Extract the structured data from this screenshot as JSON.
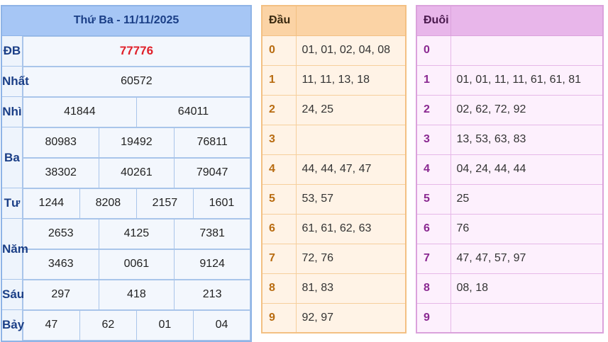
{
  "results": {
    "title": "Thứ Ba - 11/11/2025",
    "prizes": [
      {
        "name": "ĐB",
        "rows": [
          [
            "77776"
          ]
        ]
      },
      {
        "name": "Nhất",
        "rows": [
          [
            "60572"
          ]
        ]
      },
      {
        "name": "Nhì",
        "rows": [
          [
            "41844",
            "64011"
          ]
        ]
      },
      {
        "name": "Ba",
        "rows": [
          [
            "80983",
            "19492",
            "76811"
          ],
          [
            "38302",
            "40261",
            "79047"
          ]
        ]
      },
      {
        "name": "Tư",
        "rows": [
          [
            "1244",
            "8208",
            "2157",
            "1601"
          ]
        ]
      },
      {
        "name": "Năm",
        "rows": [
          [
            "2653",
            "4125",
            "7381"
          ],
          [
            "3463",
            "0061",
            "9124"
          ]
        ]
      },
      {
        "name": "Sáu",
        "rows": [
          [
            "297",
            "418",
            "213"
          ]
        ]
      },
      {
        "name": "Bảy",
        "rows": [
          [
            "47",
            "62",
            "01",
            "04"
          ]
        ]
      }
    ]
  },
  "dau": {
    "header": "Đầu",
    "rows": [
      {
        "digit": "0",
        "values": "01, 01, 02, 04, 08"
      },
      {
        "digit": "1",
        "values": "11, 11, 13, 18"
      },
      {
        "digit": "2",
        "values": "24, 25"
      },
      {
        "digit": "3",
        "values": ""
      },
      {
        "digit": "4",
        "values": "44, 44, 47, 47"
      },
      {
        "digit": "5",
        "values": "53, 57"
      },
      {
        "digit": "6",
        "values": "61, 61, 62, 63"
      },
      {
        "digit": "7",
        "values": "72, 76"
      },
      {
        "digit": "8",
        "values": "81, 83"
      },
      {
        "digit": "9",
        "values": "92, 97"
      }
    ]
  },
  "duoi": {
    "header": "Đuôi",
    "rows": [
      {
        "digit": "0",
        "values": ""
      },
      {
        "digit": "1",
        "values": "01, 01, 11, 11, 61, 61, 81"
      },
      {
        "digit": "2",
        "values": "02, 62, 72, 92"
      },
      {
        "digit": "3",
        "values": "13, 53, 63, 83"
      },
      {
        "digit": "4",
        "values": "04, 24, 44, 44"
      },
      {
        "digit": "5",
        "values": "25"
      },
      {
        "digit": "6",
        "values": "76"
      },
      {
        "digit": "7",
        "values": "47, 47, 57, 97"
      },
      {
        "digit": "8",
        "values": "08, 18"
      },
      {
        "digit": "9",
        "values": ""
      }
    ]
  },
  "colors": {
    "results_header": "#a6c6f5",
    "special_prize": "#e0202a",
    "dau_header": "#fbd3a5",
    "duoi_header": "#e8b6ea"
  }
}
